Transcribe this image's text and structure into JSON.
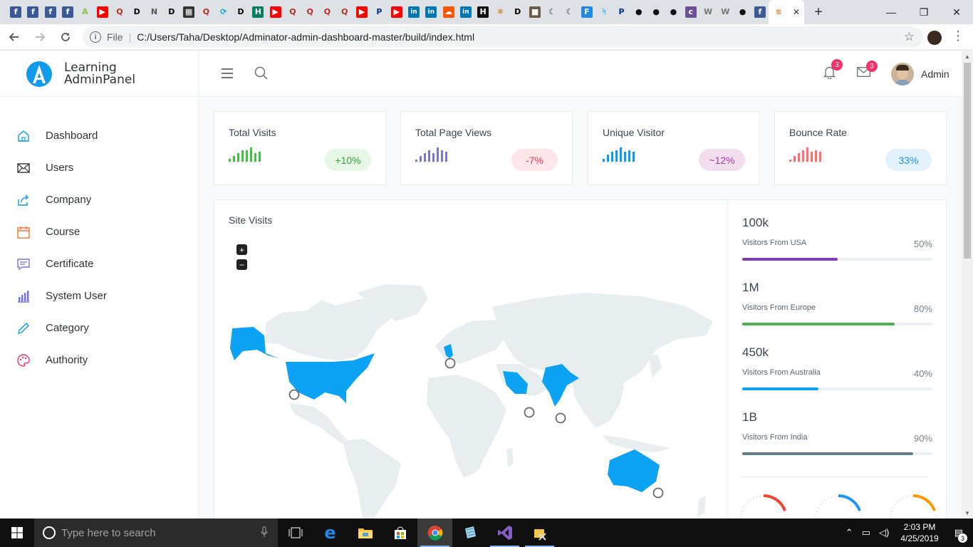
{
  "browser": {
    "tab_favicons": [
      {
        "glyph": "f",
        "bg": "#3b5998",
        "name": "facebook-icon"
      },
      {
        "glyph": "f",
        "bg": "#3b5998",
        "name": "facebook-icon"
      },
      {
        "glyph": "f",
        "bg": "#3b5998",
        "name": "facebook-icon"
      },
      {
        "glyph": "f",
        "bg": "#3b5998",
        "name": "facebook-icon"
      },
      {
        "glyph": "A",
        "bg": "#dee1e6",
        "fg": "#8bc34a",
        "name": "a-logo-icon"
      },
      {
        "glyph": "▶",
        "bg": "#ff0000",
        "name": "youtube-icon"
      },
      {
        "glyph": "Q",
        "bg": "#dee1e6",
        "fg": "#b92b27",
        "name": "quora-icon"
      },
      {
        "glyph": "D",
        "bg": "#dee1e6",
        "fg": "#000",
        "name": "dev-icon"
      },
      {
        "glyph": "N",
        "bg": "#dee1e6",
        "fg": "#555",
        "name": "n-icon"
      },
      {
        "glyph": "D",
        "bg": "#dee1e6",
        "fg": "#000",
        "name": "dev-icon"
      },
      {
        "glyph": "▦",
        "bg": "#333",
        "name": "film-icon"
      },
      {
        "glyph": "Q",
        "bg": "#dee1e6",
        "fg": "#b92b27",
        "name": "quora-icon"
      },
      {
        "glyph": "⟳",
        "bg": "#dee1e6",
        "fg": "#00a0d2",
        "name": "link-icon"
      },
      {
        "glyph": "D",
        "bg": "#dee1e6",
        "fg": "#000",
        "name": "dev-icon"
      },
      {
        "glyph": "H",
        "bg": "#008060",
        "name": "hbl-icon"
      },
      {
        "glyph": "▶",
        "bg": "#ff0000",
        "name": "youtube-icon"
      },
      {
        "glyph": "Q",
        "bg": "#dee1e6",
        "fg": "#b92b27",
        "name": "quora-icon"
      },
      {
        "glyph": "Q",
        "bg": "#dee1e6",
        "fg": "#b92b27",
        "name": "quora-icon"
      },
      {
        "glyph": "Q",
        "bg": "#dee1e6",
        "fg": "#b92b27",
        "name": "quora-icon"
      },
      {
        "glyph": "Q",
        "bg": "#dee1e6",
        "fg": "#b92b27",
        "name": "quora-icon"
      },
      {
        "glyph": "▶",
        "bg": "#ff0000",
        "name": "youtube-icon"
      },
      {
        "glyph": "P",
        "bg": "#dee1e6",
        "fg": "#003087",
        "name": "paypal-icon"
      },
      {
        "glyph": "▶",
        "bg": "#ff0000",
        "name": "youtube-icon"
      },
      {
        "glyph": "in",
        "bg": "#0077b5",
        "name": "linkedin-icon"
      },
      {
        "glyph": "in",
        "bg": "#0077b5",
        "name": "linkedin-icon"
      },
      {
        "glyph": "☁",
        "bg": "#ff5500",
        "name": "soundcloud-icon"
      },
      {
        "glyph": "in",
        "bg": "#0077b5",
        "name": "linkedin-icon"
      },
      {
        "glyph": "H",
        "bg": "#111",
        "name": "h-icon"
      },
      {
        "glyph": "✱",
        "bg": "#dee1e6",
        "fg": "#c8a060",
        "name": "react-icon"
      },
      {
        "glyph": "D",
        "bg": "#dee1e6",
        "fg": "#000",
        "name": "dev-icon"
      },
      {
        "glyph": "■",
        "bg": "#6b5a4a",
        "name": "photo-icon"
      },
      {
        "glyph": "☾",
        "bg": "#dee1e6",
        "fg": "#222",
        "name": "moon-icon"
      },
      {
        "glyph": "☾",
        "bg": "#dee1e6",
        "fg": "#222",
        "name": "moon-icon"
      },
      {
        "glyph": "F",
        "bg": "#1e88e5",
        "name": "f-icon"
      },
      {
        "glyph": "ᛋ",
        "bg": "#dee1e6",
        "fg": "#29b6f6",
        "name": "bolt-icon"
      },
      {
        "glyph": "P",
        "bg": "#dee1e6",
        "fg": "#003087",
        "name": "paypal-icon"
      },
      {
        "glyph": "●",
        "bg": "#dee1e6",
        "fg": "#111",
        "name": "github-icon"
      },
      {
        "glyph": "●",
        "bg": "#dee1e6",
        "fg": "#111",
        "name": "github-icon"
      },
      {
        "glyph": "●",
        "bg": "#dee1e6",
        "fg": "#111",
        "name": "github-icon"
      },
      {
        "glyph": "c",
        "bg": "#6c4f9c",
        "name": "colorlib-icon"
      },
      {
        "glyph": "W",
        "bg": "#dee1e6",
        "fg": "#777",
        "name": "wordpress-icon"
      },
      {
        "glyph": "W",
        "bg": "#dee1e6",
        "fg": "#777",
        "name": "wordpress-icon"
      },
      {
        "glyph": "●",
        "bg": "#dee1e6",
        "fg": "#111",
        "name": "github-icon"
      },
      {
        "glyph": "f",
        "bg": "#3b5998",
        "name": "facebook-icon"
      }
    ],
    "active_tab_close": "✕",
    "active_tab_favicon": "≋",
    "new_tab": "+",
    "window_controls": [
      "—",
      "❐",
      "✕"
    ],
    "url_scheme": "File",
    "url": "C:/Users/Taha/Desktop/Adminator-admin-dashboard-master/build/index.html"
  },
  "brand": {
    "line1": "Learning",
    "line2": "AdminPanel",
    "color": "#0f9aee"
  },
  "sidebar": {
    "items": [
      {
        "label": "Dashboard",
        "icon": "home-icon",
        "color": "#0f9aee"
      },
      {
        "label": "Users",
        "icon": "mail-icon",
        "color": "#313435"
      },
      {
        "label": "Company",
        "icon": "share-icon",
        "color": "#0f9aee"
      },
      {
        "label": "Course",
        "icon": "calendar-icon",
        "color": "#ff6f2e"
      },
      {
        "label": "Certificate",
        "icon": "chat-icon",
        "color": "#7774e7"
      },
      {
        "label": "System User",
        "icon": "bar-chart-icon",
        "color": "#7774e7"
      },
      {
        "label": "Category",
        "icon": "pencil-icon",
        "color": "#0f9aee"
      },
      {
        "label": "Authority",
        "icon": "palette-icon",
        "color": "#f5316b"
      }
    ]
  },
  "header": {
    "notifications_count": "3",
    "messages_count": "3",
    "user_name": "Admin"
  },
  "cards": [
    {
      "title": "Total Visits",
      "badge": "+10%",
      "color": "#37c936",
      "badge_bg": "#e6f7e6",
      "badge_fg": "#37a43d",
      "spark": [
        4,
        8,
        12,
        16,
        16,
        20,
        12,
        14
      ]
    },
    {
      "title": "Total Page Views",
      "badge": "-7%",
      "color": "#7774e7",
      "badge_bg": "#ffe6ea",
      "badge_fg": "#e83a4b",
      "spark": [
        3,
        8,
        12,
        16,
        12,
        20,
        16,
        14
      ]
    },
    {
      "title": "Unique Visitor",
      "badge": "~12%",
      "color": "#0f9aee",
      "badge_bg": "#f2deef",
      "badge_fg": "#9e3b99",
      "spark": [
        4,
        10,
        14,
        16,
        20,
        14,
        16,
        14
      ]
    },
    {
      "title": "Bounce Rate",
      "badge": "33%",
      "color": "#ff6f6f",
      "badge_bg": "#e3f1fc",
      "badge_fg": "#1c8fe6",
      "spark": [
        3,
        8,
        12,
        16,
        20,
        14,
        16,
        14
      ]
    }
  ],
  "site_visits": {
    "title": "Site Visits",
    "zoom_in": "+",
    "zoom_out": "−",
    "highlight_color": "#0da3f5",
    "land_color": "#e8edf0",
    "highlighted_countries": [
      "Alaska",
      "United States",
      "United Kingdom",
      "Saudi Arabia",
      "India",
      "Australia"
    ]
  },
  "stats": [
    {
      "value": "100k",
      "label": "Visitors From USA",
      "pct": "50%",
      "fraction": 0.5,
      "color": "#7b3fb3"
    },
    {
      "value": "1M",
      "label": "Visitors From Europe",
      "pct": "80%",
      "fraction": 0.8,
      "color": "#4caf50"
    },
    {
      "value": "450k",
      "label": "Visitors From Australia",
      "pct": "40%",
      "fraction": 0.4,
      "color": "#0da3f5"
    },
    {
      "value": "1B",
      "label": "Visitors From India",
      "pct": "90%",
      "fraction": 0.9,
      "color": "#607d8b"
    }
  ],
  "donut_colors": [
    "#f44336",
    "#2196f3",
    "#ff9800"
  ],
  "taskbar": {
    "search_placeholder": "Type here to search",
    "time": "2:03 PM",
    "date": "4/25/2019",
    "notification_count": "3"
  }
}
